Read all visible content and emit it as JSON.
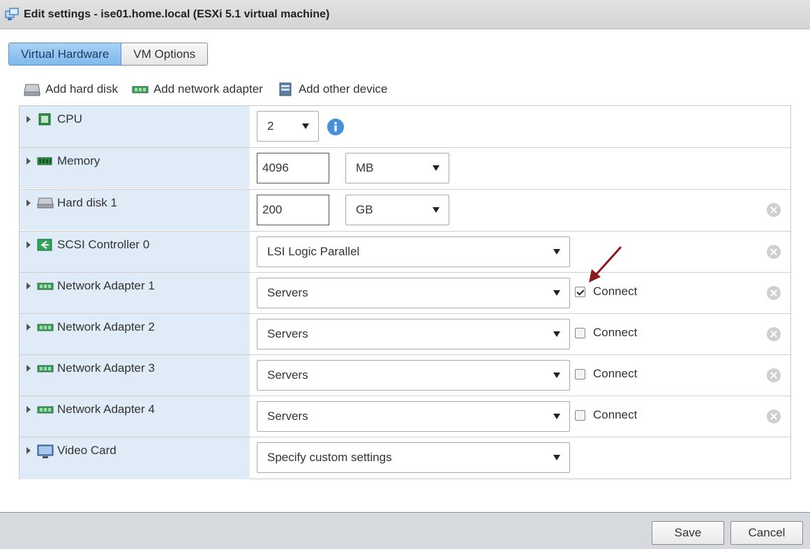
{
  "window": {
    "title": "Edit settings - ise01.home.local (ESXi 5.1 virtual machine)"
  },
  "tabs": [
    {
      "label": "Virtual Hardware",
      "active": true
    },
    {
      "label": "VM Options",
      "active": false
    }
  ],
  "toolbar": {
    "add_hard_disk": "Add hard disk",
    "add_network_adapter": "Add network adapter",
    "add_other_device": "Add other device"
  },
  "devices": {
    "cpu": {
      "label": "CPU",
      "value": "2"
    },
    "memory": {
      "label": "Memory",
      "value": "4096",
      "unit": "MB"
    },
    "hard_disk_1": {
      "label": "Hard disk 1",
      "value": "200",
      "unit": "GB"
    },
    "scsi": {
      "label": "SCSI Controller 0",
      "value": "LSI Logic Parallel"
    },
    "net1": {
      "label": "Network Adapter 1",
      "network": "Servers",
      "connect_label": "Connect",
      "connected": true
    },
    "net2": {
      "label": "Network Adapter 2",
      "network": "Servers",
      "connect_label": "Connect",
      "connected": false
    },
    "net3": {
      "label": "Network Adapter 3",
      "network": "Servers",
      "connect_label": "Connect",
      "connected": false
    },
    "net4": {
      "label": "Network Adapter 4",
      "network": "Servers",
      "connect_label": "Connect",
      "connected": false
    },
    "video": {
      "label": "Video Card",
      "value": "Specify custom settings"
    }
  },
  "footer": {
    "save": "Save",
    "cancel": "Cancel"
  },
  "colors": {
    "accent": "#80b9ec",
    "annotation_arrow": "#8b1a1a",
    "info_icon": "#4a90d9"
  }
}
